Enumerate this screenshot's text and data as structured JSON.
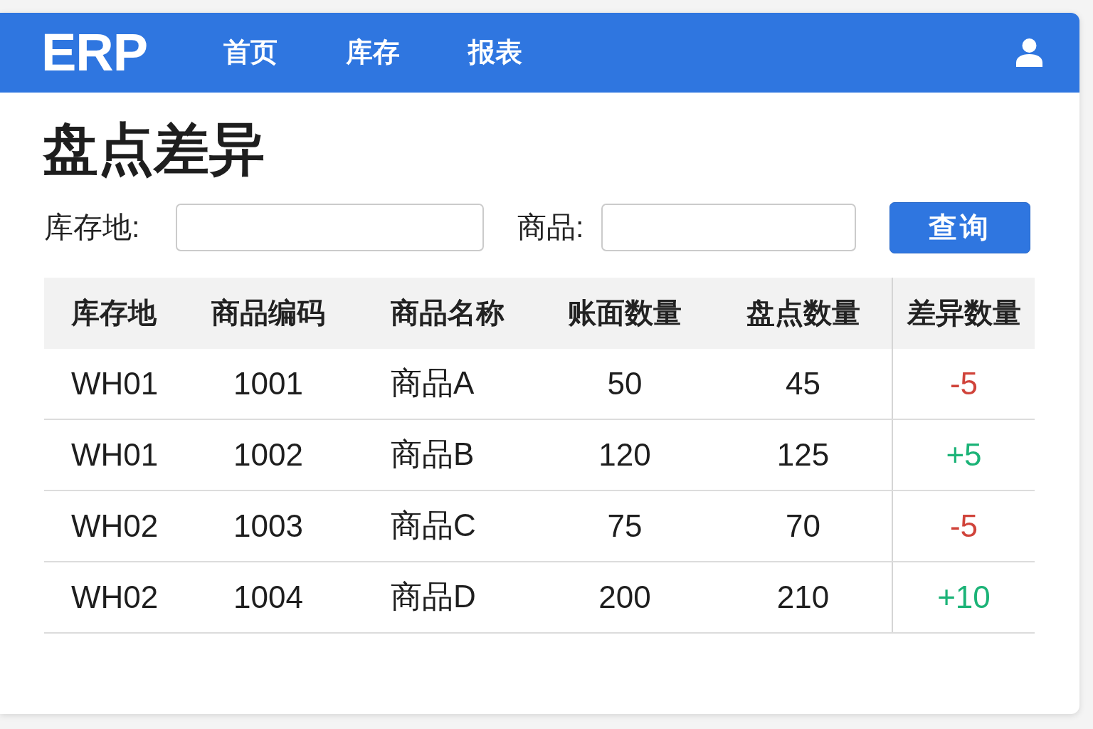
{
  "header": {
    "logo": "ERP",
    "nav": [
      "首页",
      "库存",
      "报表"
    ]
  },
  "page_title": "盘点差异",
  "filters": {
    "fields": [
      {
        "label": "库存地:"
      },
      {
        "label": "商品:"
      }
    ],
    "button": "查询"
  },
  "table": {
    "columns": [
      "库存地",
      "商品编码",
      "商品名称",
      "账面数量",
      "盘点数量",
      "差异数量"
    ],
    "rows": [
      {
        "cells": [
          "WH01",
          "1001",
          "商品A",
          "50",
          "45"
        ],
        "difference": {
          "text": "-5",
          "color": "#d0433a"
        }
      },
      {
        "cells": [
          "WH01",
          "1002",
          "商品B",
          "120",
          "125"
        ],
        "difference": {
          "text": "+5",
          "color": "#1bb377"
        }
      },
      {
        "cells": [
          "WH02",
          "1003",
          "商品C",
          "75",
          "70"
        ],
        "difference": {
          "text": "-5",
          "color": "#d0433a"
        }
      },
      {
        "cells": [
          "WH02",
          "1004",
          "商品D",
          "200",
          "210"
        ],
        "difference": {
          "text": "+10",
          "color": "#1bb377"
        }
      }
    ]
  }
}
